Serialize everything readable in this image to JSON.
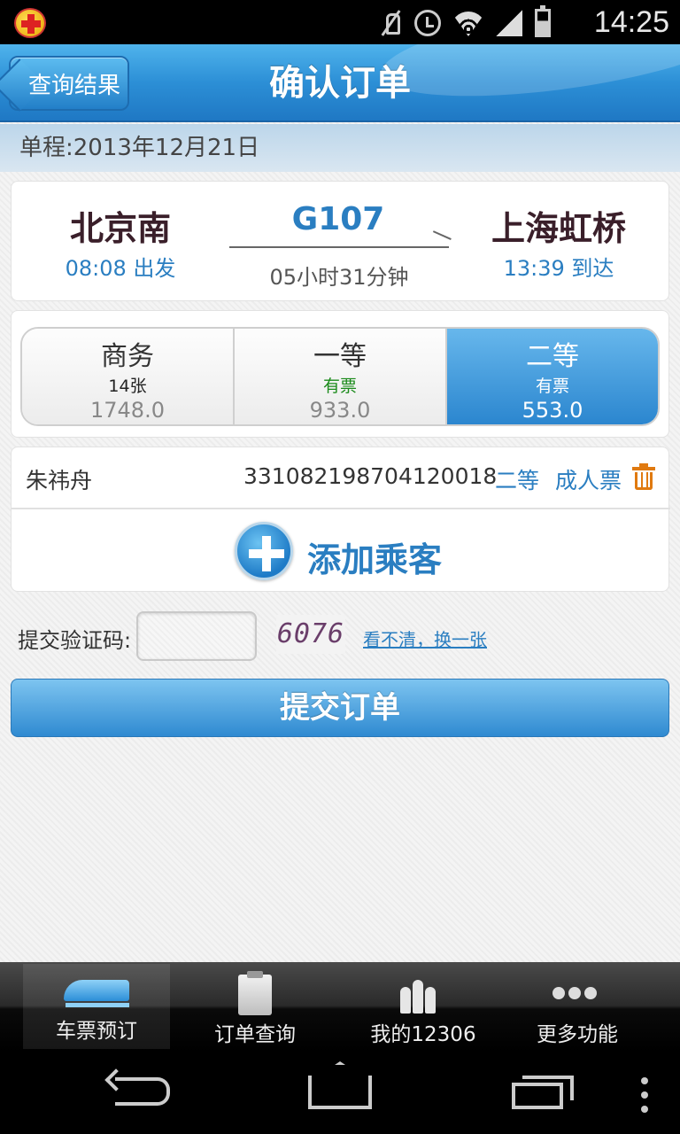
{
  "status_bar": {
    "time": "14:25",
    "icons": [
      "app-badge-icon",
      "mute-icon",
      "alarm-icon",
      "wifi-icon",
      "signal-icon",
      "battery-icon"
    ]
  },
  "header": {
    "back_label": "查询结果",
    "title": "确认订单"
  },
  "trip": {
    "date_label": "单程:2013年12月21日",
    "from_station": "北京南",
    "from_time": "08:08 出发",
    "train_no": "G107",
    "duration": "05小时31分钟",
    "to_station": "上海虹桥",
    "to_time": "13:39 到达"
  },
  "seats": [
    {
      "name": "商务",
      "availability": "14张",
      "price": "1748.0",
      "selected": false
    },
    {
      "name": "一等",
      "availability": "有票",
      "price": "933.0",
      "selected": false
    },
    {
      "name": "二等",
      "availability": "有票",
      "price": "553.0",
      "selected": true
    }
  ],
  "passenger": {
    "name": "朱祎舟",
    "id_number": "331082198704120018",
    "seat_class": "二等",
    "ticket_type": "成人票"
  },
  "add_passenger_label": "添加乘客",
  "captcha": {
    "label": "提交验证码:",
    "input_value": "",
    "image_text": "6076",
    "refresh_label": "看不清，换一张"
  },
  "submit_label": "提交订单",
  "tabs": [
    {
      "label": "车票预订",
      "icon": "train-icon",
      "active": true
    },
    {
      "label": "订单查询",
      "icon": "clipboard-icon",
      "active": false
    },
    {
      "label": "我的12306",
      "icon": "people-icon",
      "active": false
    },
    {
      "label": "更多功能",
      "icon": "more-icon",
      "active": false
    }
  ],
  "colors": {
    "accent": "#2a7ec1",
    "header_blue": "#2c8fd6",
    "trash": "#e07a10",
    "available_green": "#1a8a1a"
  }
}
